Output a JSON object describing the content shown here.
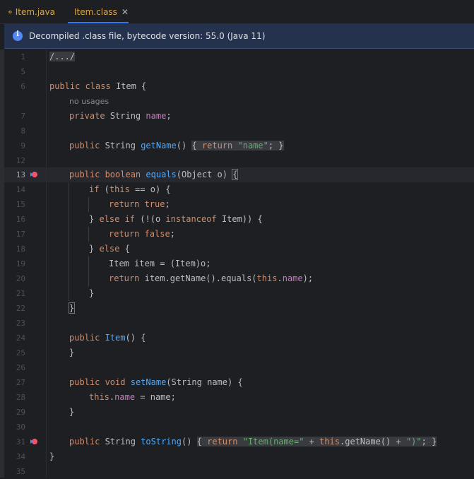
{
  "tabs": [
    {
      "label": "Item.java",
      "active": false
    },
    {
      "label": "Item.class",
      "active": true
    }
  ],
  "banner": {
    "message": "Decompiled .class file, bytecode version: 55.0 (Java 11)"
  },
  "line_numbers": [
    "1",
    "5",
    "6",
    "",
    "7",
    "8",
    "9",
    "12",
    "13",
    "14",
    "15",
    "16",
    "17",
    "18",
    "19",
    "20",
    "21",
    "22",
    "23",
    "24",
    "25",
    "26",
    "27",
    "28",
    "29",
    "30",
    "31",
    "34",
    "35"
  ],
  "code": {
    "l1": "/.../",
    "l6_kw": "public class",
    "l6_name": "Item {",
    "hint": "no usages",
    "l7_kw": "private",
    "l7_type": "String",
    "l7_field": "name",
    "l9_kw": "public",
    "l9_type": "String",
    "l9_fn": "getName",
    "l9_body_kw": "return",
    "l9_str": "\"name\"",
    "l13_kw": "public boolean",
    "l13_fn": "equals",
    "l13_params": "(Object o)",
    "l14_kw": "if",
    "l14_this": "this",
    "l14_rest": "== o) {",
    "l15_kw": "return true",
    "l16_kw1": "else if",
    "l16_mid": "(!(o",
    "l16_kw2": "instanceof",
    "l16_rest": "Item)) {",
    "l17_kw": "return false",
    "l18_kw": "else",
    "l19": "Item item = (Item)o;",
    "l20_kw": "return",
    "l20_mid": "item.getName().equals(",
    "l20_this": "this",
    "l20_field": "name",
    "l24_kw": "public",
    "l24_fn": "Item",
    "l27_kw": "public void",
    "l27_fn": "setName",
    "l27_params": "(String name) {",
    "l28_this": "this",
    "l28_field": "name",
    "l28_rest": "= name;",
    "l31_kw": "public",
    "l31_type": "String",
    "l31_fn": "toString",
    "l31_ret": "return",
    "l31_str1": "\"Item(name=\"",
    "l31_this": "this",
    "l31_mid": ".getName() +",
    "l31_str2": "\")\""
  },
  "colors": {
    "accent": "#3574f0",
    "keyword": "#cf8e6d",
    "function": "#56a8f5",
    "field": "#c77dbb",
    "string": "#6aab73",
    "background": "#1e1f22"
  }
}
